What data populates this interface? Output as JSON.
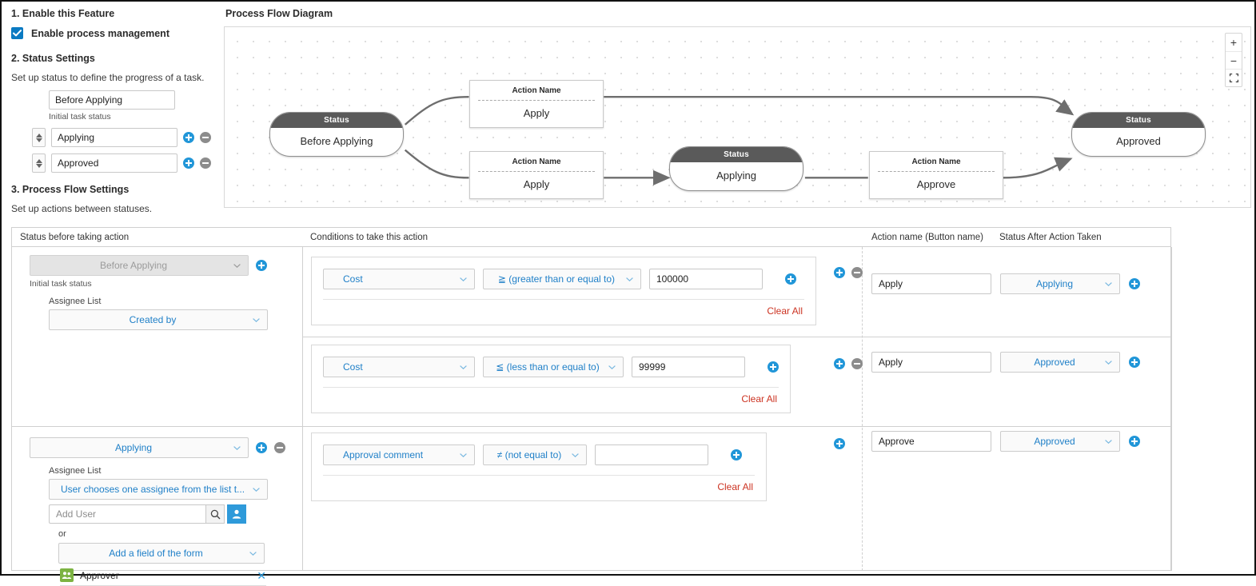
{
  "sections": {
    "enable": {
      "title": "1. Enable this Feature",
      "checkbox_label": "Enable process management"
    },
    "status": {
      "title": "2. Status Settings",
      "subtitle": "Set up status to define the progress of a task.",
      "initial_status_value": "Before Applying",
      "initial_status_hint": "Initial task status",
      "rows": [
        {
          "value": "Applying"
        },
        {
          "value": "Approved"
        }
      ]
    },
    "flow": {
      "title": "3. Process Flow Settings",
      "subtitle": "Set up actions between statuses."
    }
  },
  "diagram": {
    "title": "Process Flow Diagram",
    "status_header_label": "Status",
    "action_header_label": "Action Name",
    "nodes": [
      {
        "kind": "status",
        "name": "Before Applying"
      },
      {
        "kind": "action",
        "name": "Apply"
      },
      {
        "kind": "action",
        "name": "Apply"
      },
      {
        "kind": "status",
        "name": "Applying"
      },
      {
        "kind": "action",
        "name": "Approve"
      },
      {
        "kind": "status",
        "name": "Approved"
      }
    ],
    "controls": {
      "zoom_in": "+",
      "zoom_out": "−",
      "fit": "fit-screen"
    }
  },
  "table": {
    "headers": {
      "status_before": "Status before taking action",
      "conditions": "Conditions to take this action",
      "action_name": "Action name (Button name)",
      "status_after": "Status After Action Taken"
    },
    "groups": [
      {
        "status": "Before Applying",
        "status_disabled": true,
        "hint": "Initial task status",
        "assignee_label": "Assignee List",
        "assignee_value": "Created by"
      },
      {
        "status": "Applying",
        "status_disabled": false,
        "assignee_label": "Assignee List",
        "assignee_value": "User chooses one assignee from the list t...",
        "add_user_placeholder": "Add User",
        "or_label": "or",
        "form_field_value": "Add a field of the form",
        "assignees": [
          {
            "name": "Approver"
          }
        ]
      }
    ],
    "rows": [
      {
        "field": "Cost",
        "operator": "≧ (greater than or equal to)",
        "value": "100000",
        "clear_all": "Clear All",
        "action_name": "Apply",
        "status_after": "Applying"
      },
      {
        "field": "Cost",
        "operator": "≦ (less than or equal to)",
        "value": "99999",
        "clear_all": "Clear All",
        "action_name": "Apply",
        "status_after": "Approved"
      },
      {
        "field": "Approval comment",
        "operator": "≠ (not equal to)",
        "value": "",
        "clear_all": "Clear All",
        "action_name": "Approve",
        "status_after": "Approved"
      }
    ]
  },
  "colors": {
    "accent_blue": "#2196d8",
    "link_blue": "#2080c8",
    "clear_red": "#cc3322",
    "node_header_gray": "#5a5a5a",
    "group_icon_green": "#7cb342"
  }
}
